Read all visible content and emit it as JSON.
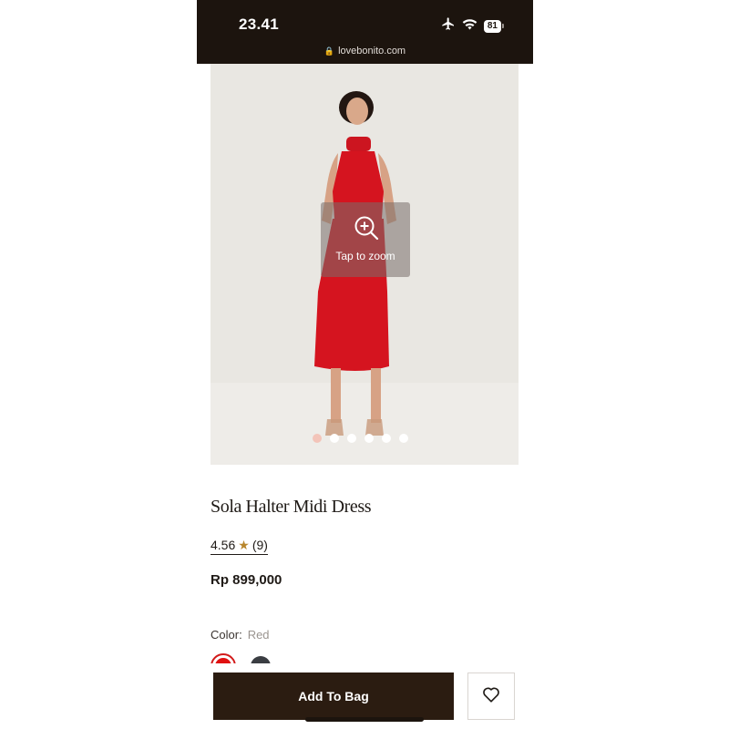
{
  "status_bar": {
    "time": "23.41",
    "battery": "81",
    "icons": [
      "airplane-icon",
      "wifi-icon",
      "battery-icon"
    ]
  },
  "browser": {
    "url": "lovebonito.com",
    "lock_icon": "lock-icon"
  },
  "gallery": {
    "zoom_text": "Tap to zoom",
    "zoom_icon": "zoom-in-icon",
    "total_images": 6,
    "active_index": 0
  },
  "product": {
    "title": "Sola Halter Midi Dress",
    "rating": "4.56",
    "rating_icon": "star-icon",
    "review_count": "(9)",
    "price": "Rp 899,000",
    "color_label": "Color:",
    "color_value": "Red",
    "swatches": [
      {
        "name": "Red",
        "hex": "#e01010",
        "selected": true
      },
      {
        "name": "Dark",
        "hex": "#3a3d42",
        "selected": false
      }
    ]
  },
  "actions": {
    "add_to_bag": "Add To Bag",
    "wishlist_icon": "heart-icon"
  },
  "colors": {
    "header_bg": "#1c140e",
    "button_bg": "#2b1c11",
    "star": "#b8862c",
    "dress": "#d5141f"
  }
}
